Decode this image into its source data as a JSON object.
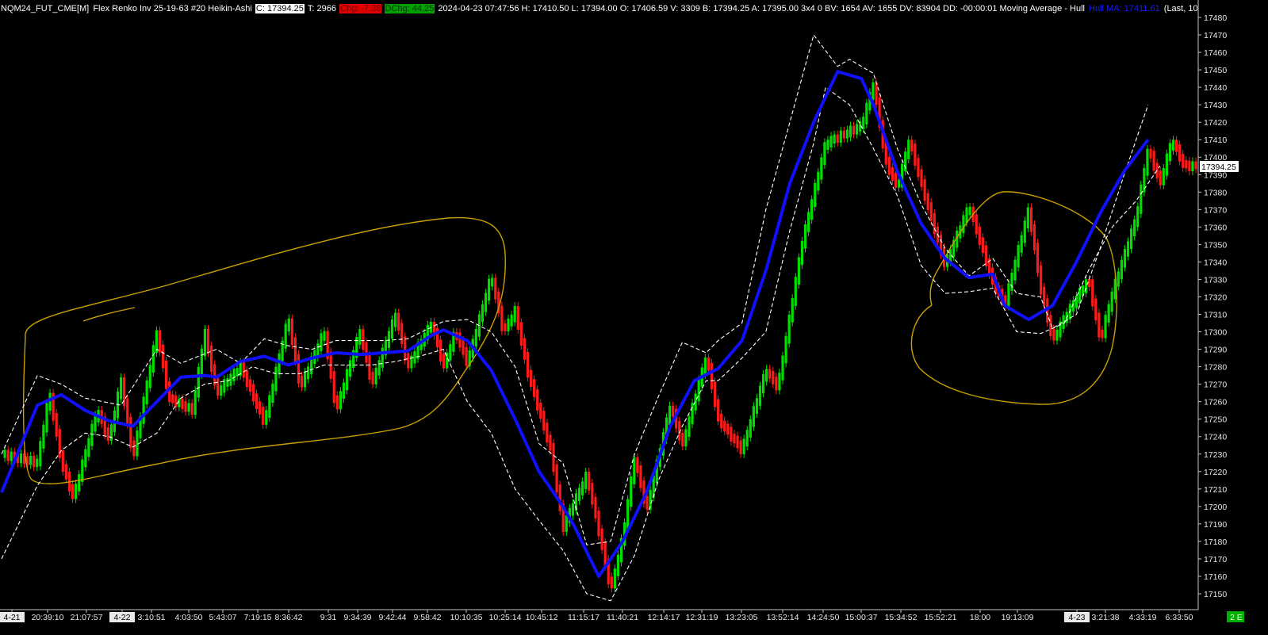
{
  "header": {
    "symbol": "NQM24_FUT_CME[M]",
    "chart_type": "Flex Renko Inv 25-19-63 #20 Heikin-Ashi",
    "close": "C: 17394.25",
    "ticks": "T: 2966",
    "chg": "Chg: -7.38",
    "dchg": "DChg: 44.25",
    "stats": "2024-04-23 07:47:56 H: 17410.50 L: 17394.00 O: 17406.59 V: 3309 B: 17394.25 A: 17395.00 3x4 0 BV: 1654 AV: 1655 DV: 83904 DD: -00:00:01 Moving Average - Hull",
    "hull_label": "Hull MA: 17411.61",
    "tail": "(Last, 10"
  },
  "price_label": "17394.25",
  "corner_label": "2 E",
  "colors": {
    "background": "#000000",
    "up_bar": "#00e000",
    "down_bar": "#ff1a1a",
    "hull_ma": "#1010ff",
    "bands": "#ffffff",
    "annotation": "#c8a000",
    "price_box": "#ffffff"
  },
  "chart_data": {
    "type": "line",
    "y_axis": {
      "ticks": [
        17480,
        17470,
        17460,
        17450,
        17440,
        17430,
        17420,
        17410,
        17400,
        17390,
        17380,
        17370,
        17360,
        17350,
        17340,
        17330,
        17320,
        17310,
        17300,
        17290,
        17280,
        17270,
        17260,
        17250,
        17240,
        17230,
        17220,
        17210,
        17200,
        17190,
        17180,
        17170,
        17160,
        17150
      ],
      "ylim": [
        17145,
        17482
      ]
    },
    "x_axis": {
      "tick_labels": [
        "4-21",
        "20:39:10",
        "21:07:57",
        "4-22",
        "3:10:51",
        "4:03:50",
        "5:43:07",
        "7:19:15",
        "8:36:42",
        "9:31",
        "9:34:39",
        "9:42:44",
        "9:58:42",
        "10:10:35",
        "10:25:14",
        "10:45:12",
        "11:15:17",
        "11:40:21",
        "12:14:17",
        "12:31:19",
        "13:23:05",
        "13:52:14",
        "14:24:50",
        "15:00:37",
        "15:34:52",
        "15:52:21",
        "18:00",
        "19:13:09",
        "4-23",
        "3:21:38",
        "4:33:19",
        "6:33:50"
      ],
      "date_boxes": [
        "4-21",
        "4-22",
        "4-23"
      ]
    },
    "price_path": [
      [
        0,
        17230
      ],
      [
        3,
        17225
      ],
      [
        4,
        17265
      ],
      [
        5,
        17225
      ],
      [
        6,
        17205
      ],
      [
        8,
        17255
      ],
      [
        9,
        17238
      ],
      [
        10,
        17272
      ],
      [
        11,
        17228
      ],
      [
        13,
        17300
      ],
      [
        14,
        17262
      ],
      [
        16,
        17255
      ],
      [
        17,
        17300
      ],
      [
        18,
        17265
      ],
      [
        20,
        17280
      ],
      [
        22,
        17248
      ],
      [
        24,
        17308
      ],
      [
        25,
        17268
      ],
      [
        27,
        17300
      ],
      [
        28,
        17255
      ],
      [
        30,
        17300
      ],
      [
        31,
        17270
      ],
      [
        33,
        17310
      ],
      [
        34,
        17280
      ],
      [
        36,
        17305
      ],
      [
        37,
        17280
      ],
      [
        38,
        17300
      ],
      [
        39,
        17282
      ],
      [
        41,
        17332
      ],
      [
        42,
        17300
      ],
      [
        43,
        17312
      ],
      [
        44,
        17278
      ],
      [
        46,
        17232
      ],
      [
        47,
        17188
      ],
      [
        49,
        17218
      ],
      [
        50,
        17186
      ],
      [
        51,
        17152
      ],
      [
        52,
        17182
      ],
      [
        53,
        17228
      ],
      [
        54,
        17198
      ],
      [
        56,
        17258
      ],
      [
        57,
        17235
      ],
      [
        59,
        17286
      ],
      [
        60,
        17250
      ],
      [
        62,
        17232
      ],
      [
        64,
        17278
      ],
      [
        65,
        17268
      ],
      [
        67,
        17350
      ],
      [
        69,
        17408
      ],
      [
        72,
        17418
      ],
      [
        73,
        17442
      ],
      [
        74,
        17398
      ],
      [
        75,
        17382
      ],
      [
        76,
        17410
      ],
      [
        77,
        17385
      ],
      [
        79,
        17338
      ],
      [
        81,
        17372
      ],
      [
        83,
        17328
      ],
      [
        84,
        17316
      ],
      [
        86,
        17370
      ],
      [
        87,
        17325
      ],
      [
        88,
        17295
      ],
      [
        89,
        17308
      ],
      [
        91,
        17330
      ],
      [
        92,
        17295
      ],
      [
        93,
        17322
      ],
      [
        95,
        17365
      ],
      [
        96,
        17405
      ],
      [
        97,
        17385
      ],
      [
        98,
        17410
      ],
      [
        99,
        17395
      ]
    ],
    "series": [
      {
        "name": "Hull MA",
        "values": [
          [
            0,
            17208
          ],
          [
            3,
            17258
          ],
          [
            5,
            17264
          ],
          [
            7,
            17255
          ],
          [
            9,
            17249
          ],
          [
            11,
            17246
          ],
          [
            13,
            17260
          ],
          [
            15,
            17274
          ],
          [
            17,
            17275
          ],
          [
            18,
            17274
          ],
          [
            20,
            17283
          ],
          [
            22,
            17286
          ],
          [
            24,
            17281
          ],
          [
            26,
            17285
          ],
          [
            28,
            17288
          ],
          [
            30,
            17287
          ],
          [
            32,
            17288
          ],
          [
            34,
            17289
          ],
          [
            36,
            17298
          ],
          [
            37,
            17301
          ],
          [
            39,
            17295
          ],
          [
            41,
            17278
          ],
          [
            43,
            17250
          ],
          [
            45,
            17220
          ],
          [
            47,
            17200
          ],
          [
            48,
            17188
          ],
          [
            50,
            17160
          ],
          [
            52,
            17180
          ],
          [
            54,
            17208
          ],
          [
            56,
            17246
          ],
          [
            58,
            17272
          ],
          [
            60,
            17279
          ],
          [
            62,
            17295
          ],
          [
            64,
            17335
          ],
          [
            66,
            17385
          ],
          [
            68,
            17420
          ],
          [
            70,
            17449
          ],
          [
            72,
            17445
          ],
          [
            73,
            17430
          ],
          [
            75,
            17392
          ],
          [
            77,
            17362
          ],
          [
            79,
            17342
          ],
          [
            81,
            17331
          ],
          [
            83,
            17333
          ],
          [
            84,
            17315
          ],
          [
            86,
            17307
          ],
          [
            88,
            17315
          ],
          [
            90,
            17340
          ],
          [
            92,
            17368
          ],
          [
            94,
            17392
          ],
          [
            96,
            17410
          ]
        ]
      },
      {
        "name": "Upper band",
        "values": [
          [
            0,
            17230
          ],
          [
            3,
            17275
          ],
          [
            5,
            17270
          ],
          [
            7,
            17262
          ],
          [
            10,
            17258
          ],
          [
            13,
            17290
          ],
          [
            15,
            17282
          ],
          [
            18,
            17290
          ],
          [
            20,
            17282
          ],
          [
            22,
            17296
          ],
          [
            24,
            17292
          ],
          [
            26,
            17290
          ],
          [
            28,
            17295
          ],
          [
            30,
            17295
          ],
          [
            32,
            17295
          ],
          [
            34,
            17296
          ],
          [
            37,
            17306
          ],
          [
            39,
            17307
          ],
          [
            41,
            17300
          ],
          [
            43,
            17280
          ],
          [
            45,
            17236
          ],
          [
            47,
            17225
          ],
          [
            49,
            17178
          ],
          [
            51,
            17180
          ],
          [
            53,
            17230
          ],
          [
            55,
            17263
          ],
          [
            57,
            17294
          ],
          [
            59,
            17288
          ],
          [
            60,
            17295
          ],
          [
            62,
            17305
          ],
          [
            64,
            17370
          ],
          [
            66,
            17420
          ],
          [
            68,
            17470
          ],
          [
            70,
            17452
          ],
          [
            71,
            17456
          ],
          [
            73,
            17448
          ],
          [
            75,
            17405
          ],
          [
            77,
            17373
          ],
          [
            79,
            17348
          ],
          [
            81,
            17332
          ],
          [
            83,
            17342
          ],
          [
            85,
            17322
          ],
          [
            87,
            17320
          ],
          [
            88,
            17302
          ],
          [
            90,
            17310
          ],
          [
            92,
            17348
          ],
          [
            94,
            17390
          ],
          [
            96,
            17430
          ]
        ]
      },
      {
        "name": "Lower band",
        "values": [
          [
            0,
            17170
          ],
          [
            3,
            17212
          ],
          [
            5,
            17232
          ],
          [
            7,
            17242
          ],
          [
            9,
            17240
          ],
          [
            11,
            17234
          ],
          [
            13,
            17242
          ],
          [
            15,
            17262
          ],
          [
            17,
            17270
          ],
          [
            19,
            17272
          ],
          [
            21,
            17280
          ],
          [
            23,
            17276
          ],
          [
            25,
            17276
          ],
          [
            27,
            17281
          ],
          [
            29,
            17281
          ],
          [
            31,
            17281
          ],
          [
            33,
            17283
          ],
          [
            35,
            17286
          ],
          [
            37,
            17290
          ],
          [
            39,
            17260
          ],
          [
            41,
            17242
          ],
          [
            43,
            17210
          ],
          [
            45,
            17192
          ],
          [
            47,
            17175
          ],
          [
            49,
            17150
          ],
          [
            51,
            17146
          ],
          [
            53,
            17172
          ],
          [
            55,
            17215
          ],
          [
            57,
            17246
          ],
          [
            59,
            17272
          ],
          [
            60,
            17272
          ],
          [
            62,
            17285
          ],
          [
            64,
            17300
          ],
          [
            66,
            17358
          ],
          [
            68,
            17408
          ],
          [
            69,
            17440
          ],
          [
            71,
            17430
          ],
          [
            73,
            17405
          ],
          [
            75,
            17378
          ],
          [
            77,
            17338
          ],
          [
            79,
            17322
          ],
          [
            81,
            17323
          ],
          [
            83,
            17325
          ],
          [
            85,
            17300
          ],
          [
            87,
            17299
          ],
          [
            89,
            17305
          ],
          [
            91,
            17335
          ],
          [
            93,
            17360
          ],
          [
            95,
            17375
          ],
          [
            97,
            17395
          ]
        ]
      }
    ]
  }
}
